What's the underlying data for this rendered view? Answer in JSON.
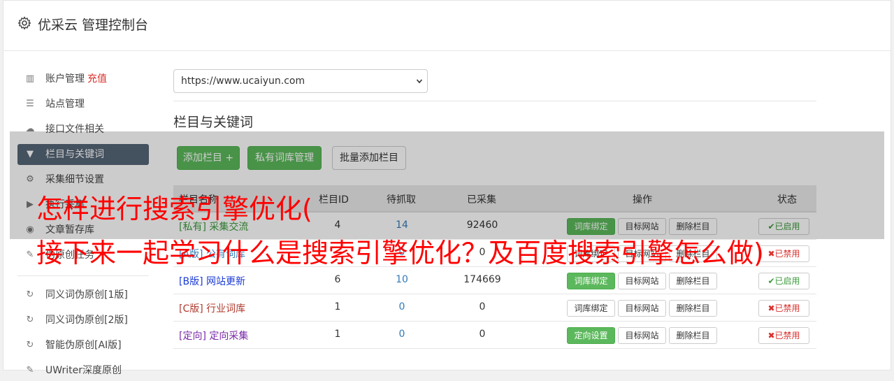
{
  "header": {
    "title": "优采云 管理控制台",
    "icon": "gear-icon"
  },
  "sidebar": {
    "items": [
      {
        "label": "账户管理",
        "extra": "充值",
        "icon": "bar-chart-icon",
        "glyph": "▥"
      },
      {
        "label": "站点管理",
        "icon": "server-icon",
        "glyph": "☰"
      },
      {
        "label": "接口文件相关",
        "icon": "cloud-upload-icon",
        "glyph": "☁"
      },
      {
        "label": "栏目与关键词",
        "icon": "filter-icon",
        "glyph": "▼"
      },
      {
        "label": "采集细节设置",
        "icon": "cogs-icon",
        "glyph": "⚙"
      },
      {
        "label": "执行采集",
        "icon": "play-icon",
        "glyph": "▶"
      },
      {
        "label": "文章暂存库",
        "icon": "database-icon",
        "glyph": "◉"
      },
      {
        "label": "伪原创任务",
        "icon": "edit-icon",
        "glyph": "✎"
      },
      {
        "label": "同义词伪原创[1版]",
        "icon": "refresh-icon",
        "glyph": "↻"
      },
      {
        "label": "同义词伪原创[2版]",
        "icon": "refresh-icon",
        "glyph": "↻"
      },
      {
        "label": "智能伪原创[AI版]",
        "icon": "refresh-icon",
        "glyph": "↻"
      },
      {
        "label": "UWriter深度原创",
        "icon": "edit-icon",
        "glyph": "✎"
      }
    ]
  },
  "main": {
    "site_select": "https://www.ucaiyun.com",
    "section_title": "栏目与关键词",
    "buttons": {
      "add_column": "添加栏目 +",
      "private_lib": "私有词库管理",
      "batch_add": "批量添加栏目"
    },
    "table": {
      "headers": {
        "name": "栏目名称",
        "id": "栏目ID",
        "pending": "待抓取",
        "collected": "已采集",
        "ops": "操作",
        "status": "状态"
      },
      "rows": [
        {
          "name": "[私有] 采集交流",
          "id": "4",
          "pending": "14",
          "collected": "92460",
          "op1": "词库绑定",
          "op2": "目标网站",
          "op3": "删除栏目",
          "status": "✔已启用",
          "name_color": "#3c9a3c",
          "op1_green": true,
          "enabled": true
        },
        {
          "name": "[A版] 公有词库",
          "id": "",
          "pending": "0",
          "collected": "0",
          "op1": "词库绑定",
          "op2": "目标网站",
          "op3": "删除栏目",
          "status": "✖已禁用",
          "name_color": "#337ab7",
          "op1_green": false,
          "enabled": false
        },
        {
          "name": "[B版] 网站更新",
          "id": "6",
          "pending": "10",
          "collected": "174669",
          "op1": "词库绑定",
          "op2": "目标网站",
          "op3": "删除栏目",
          "status": "✔已启用",
          "name_color": "#1a3ad8",
          "op1_green": true,
          "enabled": true
        },
        {
          "name": "[C版] 行业词库",
          "id": "1",
          "pending": "0",
          "collected": "0",
          "op1": "词库绑定",
          "op2": "目标网站",
          "op3": "删除栏目",
          "status": "✖已禁用",
          "name_color": "#b03a2e",
          "op1_green": false,
          "enabled": false
        },
        {
          "name": "[定向] 定向采集",
          "id": "1",
          "pending": "0",
          "collected": "0",
          "op1": "定向设置",
          "op2": "目标网站",
          "op3": "删除栏目",
          "status": "✖已禁用",
          "name_color": "#7a2aa8",
          "op1_green": true,
          "enabled": false
        }
      ]
    }
  },
  "overlay": {
    "line1": "怎样进行搜索引擎优化(",
    "line2": "接下来一起学习什么是搜索引擎优化？及百度搜索引擎怎么做)"
  }
}
